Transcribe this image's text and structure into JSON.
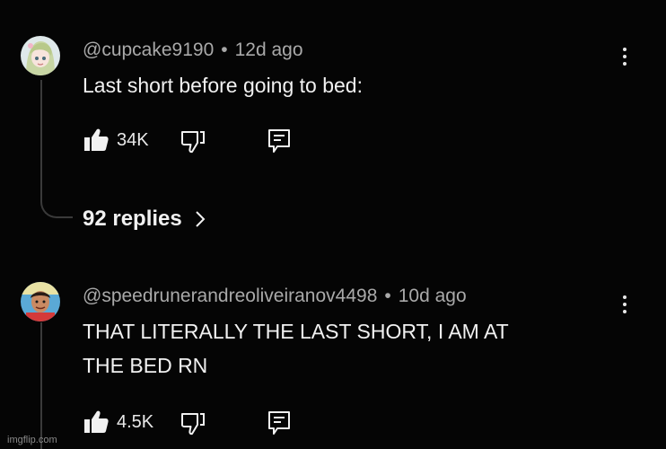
{
  "comments": [
    {
      "author": "@cupcake9190",
      "separator": "•",
      "time": "12d ago",
      "text": "Last short before going to bed:",
      "likes": "34K",
      "replies": "92 replies",
      "avatar_icon": "anime-girl-avatar"
    },
    {
      "author": "@speedrunerandreoliveiranov4498",
      "separator": "•",
      "time": "10d ago",
      "text_line1": "THAT LITERALLY THE LAST SHORT, I AM AT",
      "text_line2": "THE BED RN",
      "likes": "4.5K",
      "avatar_icon": "man-portrait-avatar"
    }
  ],
  "icons": {
    "like": "thumbs-up-icon",
    "dislike": "thumbs-down-icon",
    "reply": "reply-icon",
    "more": "kebab-menu-icon",
    "chevron": "chevron-right-icon"
  },
  "watermark": "imgflip.com"
}
